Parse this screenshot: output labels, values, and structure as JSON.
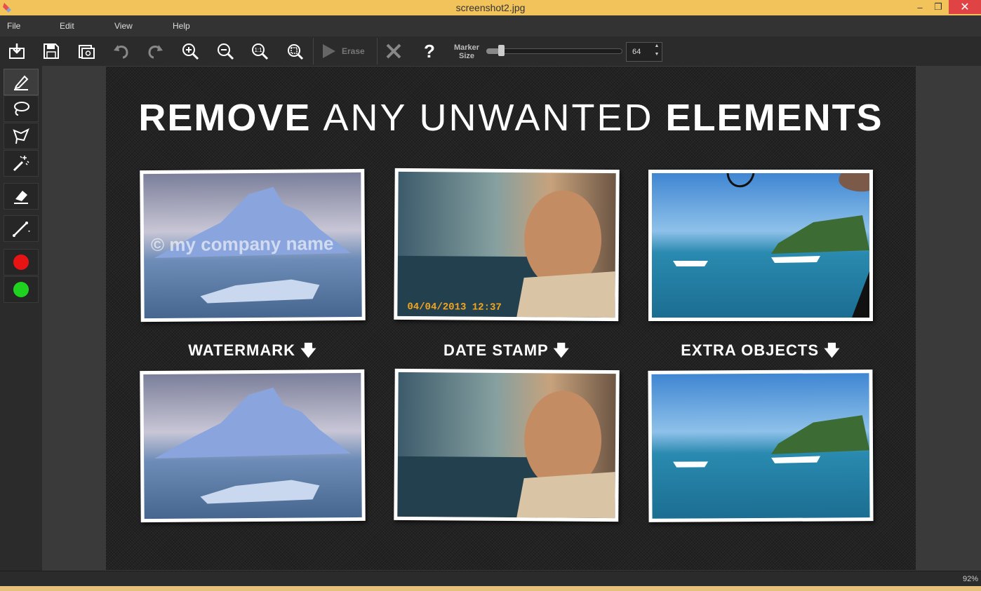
{
  "window": {
    "title": "screenshot2.jpg",
    "minimize": "–",
    "maximize": "❐",
    "close": "✕"
  },
  "menu": [
    "File",
    "Edit",
    "View",
    "Help"
  ],
  "toolbar": {
    "open_icon": "open-icon",
    "save_icon": "save-icon",
    "save_as_icon": "save-as-icon",
    "undo_icon": "undo-icon",
    "redo_icon": "redo-icon",
    "zoom_in_icon": "zoom-in-icon",
    "zoom_out_icon": "zoom-out-icon",
    "actual_size_icon": "actual-size-icon",
    "fit_icon": "fit-icon",
    "erase_label": "Erase",
    "cancel_icon": "cancel-icon",
    "help_icon": "help-icon",
    "marker_label_1": "Marker",
    "marker_label_2": "Size",
    "marker_size": "64",
    "marker_fraction": 0.1
  },
  "left_tools": [
    "marker-tool",
    "lasso-tool",
    "polygon-lasso-tool",
    "magic-wand-tool",
    "eraser-tool",
    "line-tool",
    "red-color",
    "green-color"
  ],
  "colors": {
    "red": "#e81414",
    "green": "#1fd21f",
    "titlebar": "#f3c35b",
    "close": "#e04343"
  },
  "canvas": {
    "headline_bold_1": "REMOVE",
    "headline_thin": "ANY UNWANTED",
    "headline_bold_2": "ELEMENTS",
    "watermark_text": "© my company name",
    "date_stamp": "04/04/2013  12:37",
    "captions": [
      "WATERMARK",
      "DATE STAMP",
      "EXTRA OBJECTS"
    ]
  },
  "status": {
    "zoom": "92%"
  }
}
